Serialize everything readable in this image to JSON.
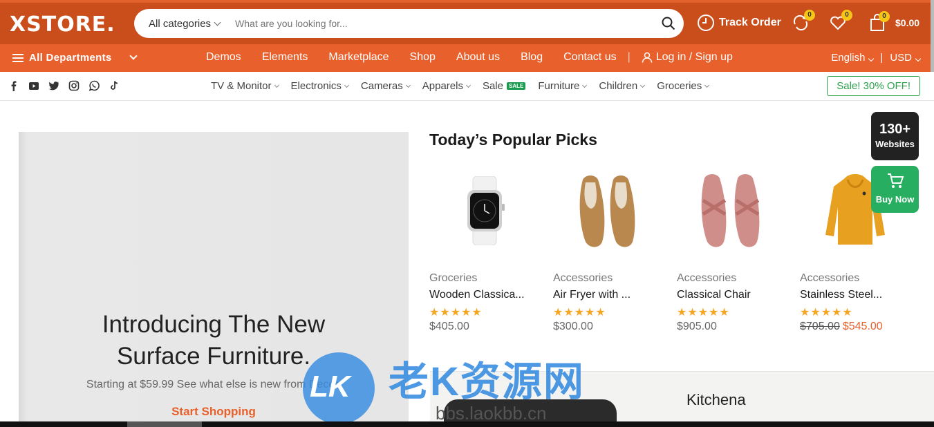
{
  "header": {
    "logo": "XSTORE.",
    "search_category": "All categories",
    "search_placeholder": "What are you looking for...",
    "track_order": "Track Order",
    "compare_count": "0",
    "wishlist_count": "0",
    "cart_count": "0",
    "cart_total": "$0.00"
  },
  "nav": {
    "departments": "All Departments",
    "items": [
      "Demos",
      "Elements",
      "Marketplace",
      "Shop",
      "About us",
      "Blog",
      "Contact us"
    ],
    "login": "Log in / Sign up",
    "language": "English",
    "currency": "USD"
  },
  "categories": {
    "items": [
      "TV & Monitor",
      "Electronics",
      "Cameras",
      "Apparels",
      "Sale",
      "Furniture",
      "Children",
      "Groceries"
    ],
    "sale_tag": "SALE",
    "sale_button": "Sale! 30% OFF!"
  },
  "hero": {
    "title_line1": "Introducing The New",
    "title_line2": "Surface Furniture.",
    "subtitle": "Starting at $59.99 See what else is new from Decor.",
    "cta": "Start Shopping"
  },
  "picks": {
    "title": "Today’s Popular Picks",
    "products": [
      {
        "category": "Groceries",
        "name": "Wooden Classica...",
        "rating": 5,
        "price": "$405.00"
      },
      {
        "category": "Accessories",
        "name": "Air Fryer with ...",
        "rating": 5,
        "price": "$300.00"
      },
      {
        "category": "Accessories",
        "name": "Classical Chair",
        "rating": 5,
        "price": "$905.00"
      },
      {
        "category": "Accessories",
        "name": "Stainless Steel...",
        "rating": 5,
        "old_price": "$705.00",
        "price": "$545.00"
      }
    ]
  },
  "floating": {
    "websites_count": "130+",
    "websites_label": "Websites",
    "buy_now": "Buy Now"
  },
  "banner": {
    "title": "Kitchena"
  },
  "watermark": {
    "logo": "LK",
    "text": "老K资源网",
    "url": "bbs.laokbb.cn"
  },
  "colors": {
    "header_dark": "#c94e1c",
    "nav_orange": "#e8602c",
    "sale_green": "#2aa14a",
    "star": "#f5a623"
  }
}
